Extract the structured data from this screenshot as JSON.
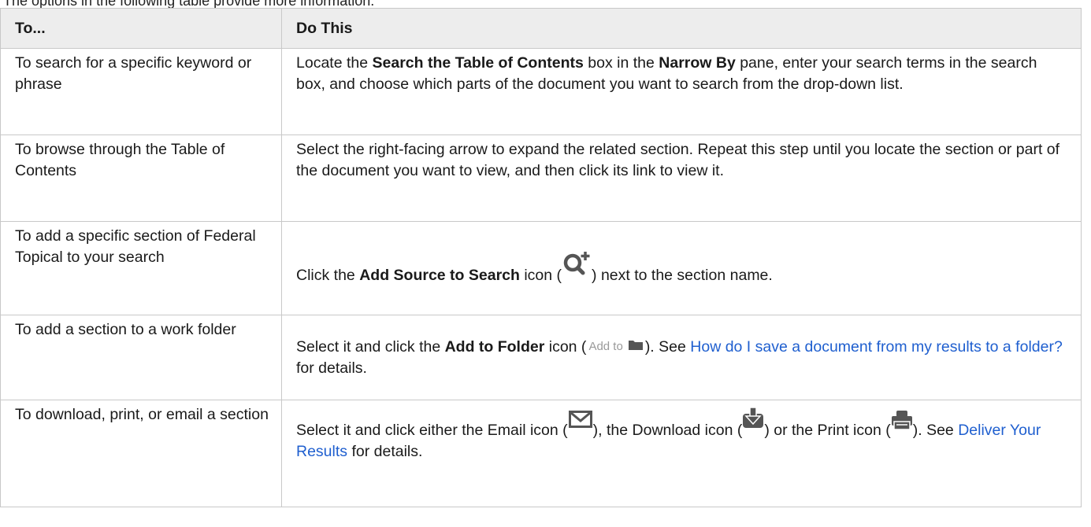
{
  "intro_text": "The options in the following table provide more information.",
  "table": {
    "headers": {
      "col1": "To...",
      "col2": "Do This"
    },
    "rows": [
      {
        "action": "To search for a specific keyword or phrase",
        "p1": "Locate the ",
        "b1": "Search the Table of Contents",
        "p2": " box in the ",
        "b2": "Narrow By",
        "p3": " pane, enter your search terms in the search box, and choose which parts of the document you want to search from the drop-down list."
      },
      {
        "action": "To browse through the Table of Contents",
        "p1": "Select the right-facing arrow to expand the related section. Repeat this step until you locate the section or part of the document you want to view, and then click its link to view it."
      },
      {
        "action": "To add a specific section of Federal Topical to your search",
        "p1": "Click the ",
        "b1": "Add Source to Search",
        "p2": " icon (",
        "p3": ") next to the section name."
      },
      {
        "action": "To add a section to a work folder",
        "p1": "Select it and click the ",
        "b1": "Add to Folder",
        "p2": " icon (",
        "icon_label": "Add to",
        "p3": "). See ",
        "link": "How do I save a document from my results to a folder?",
        "p4": " for details."
      },
      {
        "action": "To download, print, or email a section",
        "p1": "Select it and click either the Email icon (",
        "p2": "), the Download icon (",
        "p3": ") or the Print icon (",
        "p4": "). See ",
        "link": "Deliver Your Results",
        "p5": " for details."
      }
    ]
  },
  "icons": {
    "add_source": "add-source-search-icon",
    "folder": "folder-icon",
    "email": "email-icon",
    "download": "download-icon",
    "print": "print-icon"
  },
  "colors": {
    "link": "#1f5fcf",
    "header_bg": "#ededed",
    "icon": "#555555"
  }
}
